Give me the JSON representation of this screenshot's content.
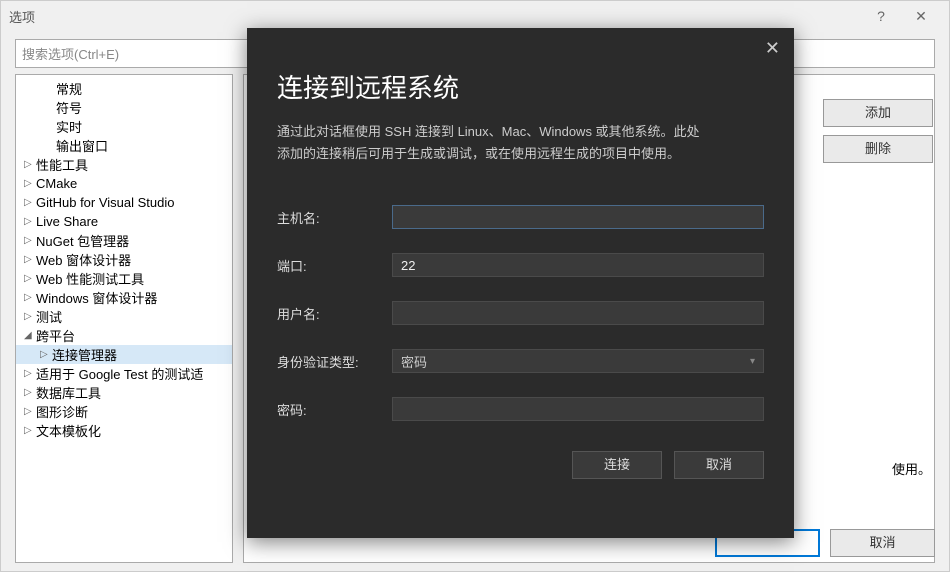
{
  "options": {
    "title": "选项",
    "search_placeholder": "搜索选项(Ctrl+E)",
    "tree": {
      "general": "常规",
      "symbols": "符号",
      "realtime": "实时",
      "output_window": "输出窗口",
      "perf_tools": "性能工具",
      "cmake": "CMake",
      "github": "GitHub for Visual Studio",
      "liveshare": "Live Share",
      "nuget": "NuGet 包管理器",
      "web_forms": "Web 窗体设计器",
      "web_perf": "Web 性能测试工具",
      "win_forms": "Windows 窗体设计器",
      "test": "测试",
      "crossplat": "跨平台",
      "conn_mgr": "连接管理器",
      "gtest": "适用于 Google Test 的测试适",
      "db_tools": "数据库工具",
      "graphics": "图形诊断",
      "text_tmpl": "文本模板化"
    },
    "buttons": {
      "add": "添加",
      "delete": "删除",
      "ok": "",
      "cancel": "取消"
    },
    "hint": "使用。"
  },
  "modal": {
    "title": "连接到远程系统",
    "desc_line1": "通过此对话框使用 SSH 连接到 Linux、Mac、Windows 或其他系统。此处",
    "desc_line2": "添加的连接稍后可用于生成或调试，或在使用远程生成的项目中使用。",
    "fields": {
      "host_label": "主机名:",
      "host_value": "",
      "port_label": "端口:",
      "port_value": "22",
      "user_label": "用户名:",
      "user_value": "",
      "auth_label": "身份验证类型:",
      "auth_value": "密码",
      "pass_label": "密码:",
      "pass_value": ""
    },
    "buttons": {
      "connect": "连接",
      "cancel": "取消"
    }
  }
}
